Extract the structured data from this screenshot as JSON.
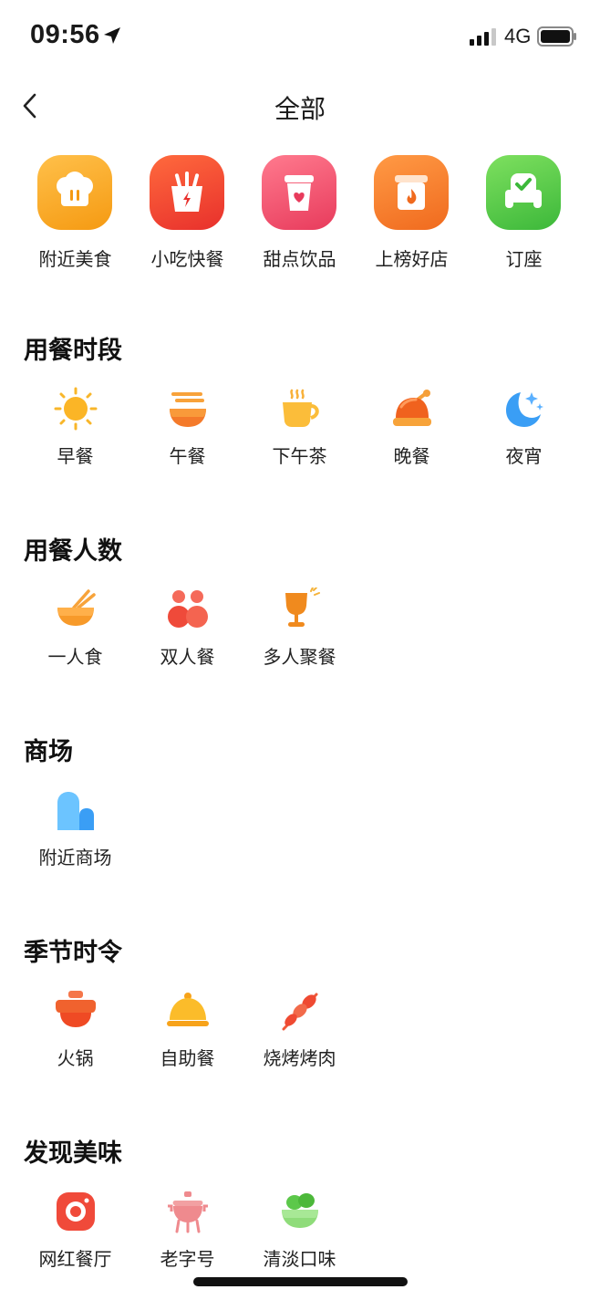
{
  "status_bar": {
    "time": "09:56",
    "network": "4G"
  },
  "nav": {
    "title": "全部",
    "back_icon": "chevron-left-icon"
  },
  "top_categories": [
    {
      "label": "附近美食",
      "icon": "chef-hat-icon",
      "color": "#f7a21d"
    },
    {
      "label": "小吃快餐",
      "icon": "fries-box-icon",
      "color": "#ef4a34"
    },
    {
      "label": "甜点饮品",
      "icon": "drink-cup-icon",
      "color": "#ee4d6a"
    },
    {
      "label": "上榜好店",
      "icon": "hot-store-icon",
      "color": "#f5772b"
    },
    {
      "label": "订座",
      "icon": "reserved-seat-icon",
      "color": "#52c743"
    }
  ],
  "sections": [
    {
      "title": "用餐时段",
      "items": [
        {
          "label": "早餐",
          "icon": "sun-icon"
        },
        {
          "label": "午餐",
          "icon": "noodle-bowl-icon"
        },
        {
          "label": "下午茶",
          "icon": "coffee-cup-icon"
        },
        {
          "label": "晚餐",
          "icon": "roast-chicken-icon"
        },
        {
          "label": "夜宵",
          "icon": "moon-stars-icon"
        }
      ]
    },
    {
      "title": "用餐人数",
      "items": [
        {
          "label": "一人食",
          "icon": "rice-bowl-icon"
        },
        {
          "label": "双人餐",
          "icon": "two-people-icon"
        },
        {
          "label": "多人聚餐",
          "icon": "wine-glass-icon"
        }
      ]
    },
    {
      "title": "商场",
      "items": [
        {
          "label": "附近商场",
          "icon": "mall-building-icon"
        }
      ]
    },
    {
      "title": "季节时令",
      "items": [
        {
          "label": "火锅",
          "icon": "hotpot-icon"
        },
        {
          "label": "自助餐",
          "icon": "food-cloche-icon"
        },
        {
          "label": "烧烤烤肉",
          "icon": "bbq-skewer-icon"
        }
      ]
    },
    {
      "title": "发现美味",
      "items": [
        {
          "label": "网红餐厅",
          "icon": "camera-icon"
        },
        {
          "label": "老字号",
          "icon": "ancient-cauldron-icon"
        },
        {
          "label": "清淡口味",
          "icon": "salad-bowl-icon"
        }
      ]
    }
  ]
}
